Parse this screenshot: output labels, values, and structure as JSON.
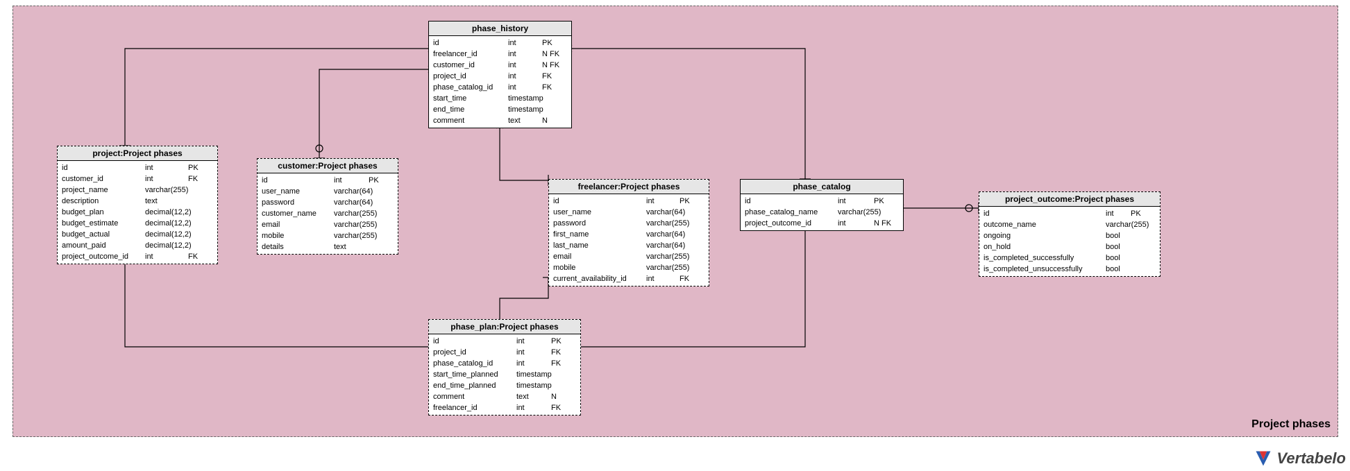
{
  "brand": "Vertabelo",
  "area": {
    "label": "Project phases"
  },
  "tables": {
    "phase_history": {
      "title": "phase_history",
      "cols": [
        {
          "n": "id",
          "t": "int",
          "k": "PK"
        },
        {
          "n": "freelancer_id",
          "t": "int",
          "k": "N FK"
        },
        {
          "n": "customer_id",
          "t": "int",
          "k": "N FK"
        },
        {
          "n": "project_id",
          "t": "int",
          "k": "FK"
        },
        {
          "n": "phase_catalog_id",
          "t": "int",
          "k": "FK"
        },
        {
          "n": "start_time",
          "t": "timestamp",
          "k": ""
        },
        {
          "n": "end_time",
          "t": "timestamp",
          "k": ""
        },
        {
          "n": "comment",
          "t": "text",
          "k": "N"
        }
      ]
    },
    "project": {
      "title": "project:Project phases",
      "cols": [
        {
          "n": "id",
          "t": "int",
          "k": "PK"
        },
        {
          "n": "customer_id",
          "t": "int",
          "k": "FK"
        },
        {
          "n": "project_name",
          "t": "varchar(255)",
          "k": ""
        },
        {
          "n": "description",
          "t": "text",
          "k": ""
        },
        {
          "n": "budget_plan",
          "t": "decimal(12,2)",
          "k": ""
        },
        {
          "n": "budget_estimate",
          "t": "decimal(12,2)",
          "k": ""
        },
        {
          "n": "budget_actual",
          "t": "decimal(12,2)",
          "k": ""
        },
        {
          "n": "amount_paid",
          "t": "decimal(12,2)",
          "k": ""
        },
        {
          "n": "project_outcome_id",
          "t": "int",
          "k": "FK"
        }
      ]
    },
    "customer": {
      "title": "customer:Project phases",
      "cols": [
        {
          "n": "id",
          "t": "int",
          "k": "PK"
        },
        {
          "n": "user_name",
          "t": "varchar(64)",
          "k": ""
        },
        {
          "n": "password",
          "t": "varchar(64)",
          "k": ""
        },
        {
          "n": "customer_name",
          "t": "varchar(255)",
          "k": ""
        },
        {
          "n": "email",
          "t": "varchar(255)",
          "k": ""
        },
        {
          "n": "mobile",
          "t": "varchar(255)",
          "k": ""
        },
        {
          "n": "details",
          "t": "text",
          "k": ""
        }
      ]
    },
    "freelancer": {
      "title": "freelancer:Project phases",
      "cols": [
        {
          "n": "id",
          "t": "int",
          "k": "PK"
        },
        {
          "n": "user_name",
          "t": "varchar(64)",
          "k": ""
        },
        {
          "n": "password",
          "t": "varchar(255)",
          "k": ""
        },
        {
          "n": "first_name",
          "t": "varchar(64)",
          "k": ""
        },
        {
          "n": "last_name",
          "t": "varchar(64)",
          "k": ""
        },
        {
          "n": "email",
          "t": "varchar(255)",
          "k": ""
        },
        {
          "n": "mobile",
          "t": "varchar(255)",
          "k": ""
        },
        {
          "n": "current_availability_id",
          "t": "int",
          "k": "FK"
        }
      ]
    },
    "phase_catalog": {
      "title": "phase_catalog",
      "cols": [
        {
          "n": "id",
          "t": "int",
          "k": "PK"
        },
        {
          "n": "phase_catalog_name",
          "t": "varchar(255)",
          "k": ""
        },
        {
          "n": "project_outcome_id",
          "t": "int",
          "k": "N FK"
        }
      ]
    },
    "project_outcome": {
      "title": "project_outcome:Project phases",
      "cols": [
        {
          "n": "id",
          "t": "int",
          "k": "PK"
        },
        {
          "n": "outcome_name",
          "t": "varchar(255)",
          "k": ""
        },
        {
          "n": "ongoing",
          "t": "bool",
          "k": ""
        },
        {
          "n": "on_hold",
          "t": "bool",
          "k": ""
        },
        {
          "n": "is_completed_successfully",
          "t": "bool",
          "k": ""
        },
        {
          "n": "is_completed_unsuccessfully",
          "t": "bool",
          "k": ""
        }
      ]
    },
    "phase_plan": {
      "title": "phase_plan:Project phases",
      "cols": [
        {
          "n": "id",
          "t": "int",
          "k": "PK"
        },
        {
          "n": "project_id",
          "t": "int",
          "k": "FK"
        },
        {
          "n": "phase_catalog_id",
          "t": "int",
          "k": "FK"
        },
        {
          "n": "start_time_planned",
          "t": "timestamp",
          "k": ""
        },
        {
          "n": "end_time_planned",
          "t": "timestamp",
          "k": ""
        },
        {
          "n": "comment",
          "t": "text",
          "k": "N"
        },
        {
          "n": "freelancer_id",
          "t": "int",
          "k": "FK"
        }
      ]
    }
  },
  "chart_data": {
    "type": "erd",
    "entities": [
      "phase_history",
      "project",
      "customer",
      "freelancer",
      "phase_catalog",
      "project_outcome",
      "phase_plan"
    ],
    "relationships": [
      {
        "from": "phase_history",
        "to": "project",
        "fk": "project_id",
        "card": "many-to-one"
      },
      {
        "from": "phase_history",
        "to": "customer",
        "fk": "customer_id",
        "card": "many-to-one",
        "nullable": true
      },
      {
        "from": "phase_history",
        "to": "freelancer",
        "fk": "freelancer_id",
        "card": "many-to-one",
        "nullable": true
      },
      {
        "from": "phase_history",
        "to": "phase_catalog",
        "fk": "phase_catalog_id",
        "card": "many-to-one"
      },
      {
        "from": "phase_catalog",
        "to": "project_outcome",
        "fk": "project_outcome_id",
        "card": "many-to-one",
        "nullable": true
      },
      {
        "from": "phase_plan",
        "to": "project",
        "fk": "project_id",
        "card": "many-to-one"
      },
      {
        "from": "phase_plan",
        "to": "freelancer",
        "fk": "freelancer_id",
        "card": "many-to-one"
      },
      {
        "from": "phase_plan",
        "to": "phase_catalog",
        "fk": "phase_catalog_id",
        "card": "many-to-one"
      }
    ]
  }
}
